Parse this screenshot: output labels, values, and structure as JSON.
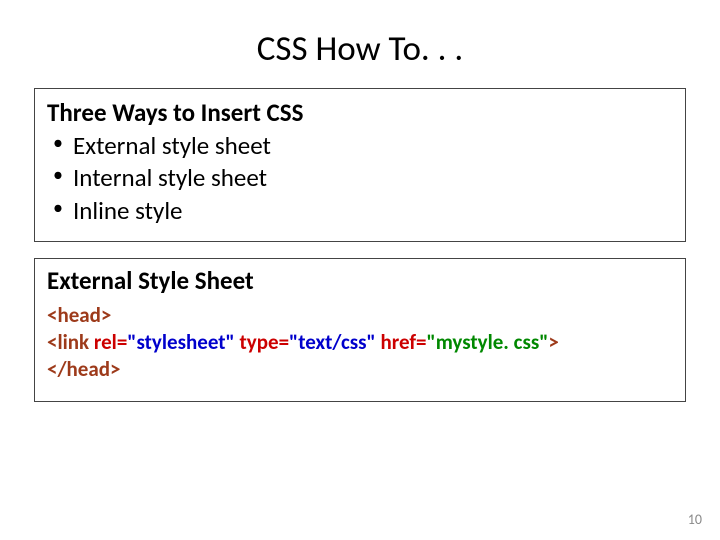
{
  "title": "CSS How To. . .",
  "box1": {
    "heading": "Three Ways to Insert CSS",
    "items": [
      "External style sheet",
      "Internal style sheet",
      "Inline style"
    ]
  },
  "box2": {
    "heading": "External Style Sheet",
    "code": {
      "line1": "<head>",
      "line2": {
        "p1": "<link ",
        "p2": "rel=",
        "p3": "\"stylesheet\"",
        "p4": " type=",
        "p5": "\"text/css\"",
        "p6": " href=",
        "p7": "\"mystyle. css\"",
        "p8": ">"
      },
      "line3": "</head>"
    }
  },
  "pageNumber": "10"
}
